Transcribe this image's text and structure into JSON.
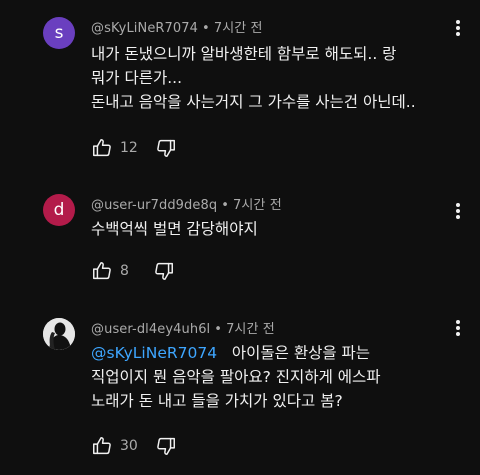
{
  "comments": [
    {
      "author": "@sKyLiNeR7074",
      "time": "7시간 전",
      "avatar_letter": "s",
      "avatar_color": "#6a3fbf",
      "lines": [
        "내가 돈냈으니까 알바생한테 함부로 해도되.. 랑",
        "뭐가 다른가...",
        "돈내고 음악을 사는거지 그 가수를 사는건 아닌데.."
      ],
      "likes": "12"
    },
    {
      "author": "@user-ur7dd9de8q",
      "time": "7시간 전",
      "avatar_letter": "d",
      "avatar_color": "#b31b4a",
      "lines": [
        "수백억씩 벌면 감당해야지"
      ],
      "likes": "8"
    },
    {
      "author": "@user-dl4ey4uh6l",
      "time": "7시간 전",
      "avatar_icon": "silhouette-photo-avatar",
      "mention": "@sKyLiNeR7074",
      "first_line_rest": "아이돌은 환상을 파는",
      "lines": [
        "직업이지 뭔 음악을 팔아요?  진지하게 에스파",
        "노래가 돈 내고 들을 가치가 있다고 봄?"
      ],
      "likes": "30"
    }
  ],
  "icons": {
    "like": "thumbs-up-icon",
    "dislike": "thumbs-down-icon",
    "menu": "more-vert-icon"
  },
  "colors": {
    "background": "#0f0f0f",
    "text": "#f1f1f1",
    "secondary_text": "#aaaaaa",
    "mention": "#3ea6ff"
  }
}
